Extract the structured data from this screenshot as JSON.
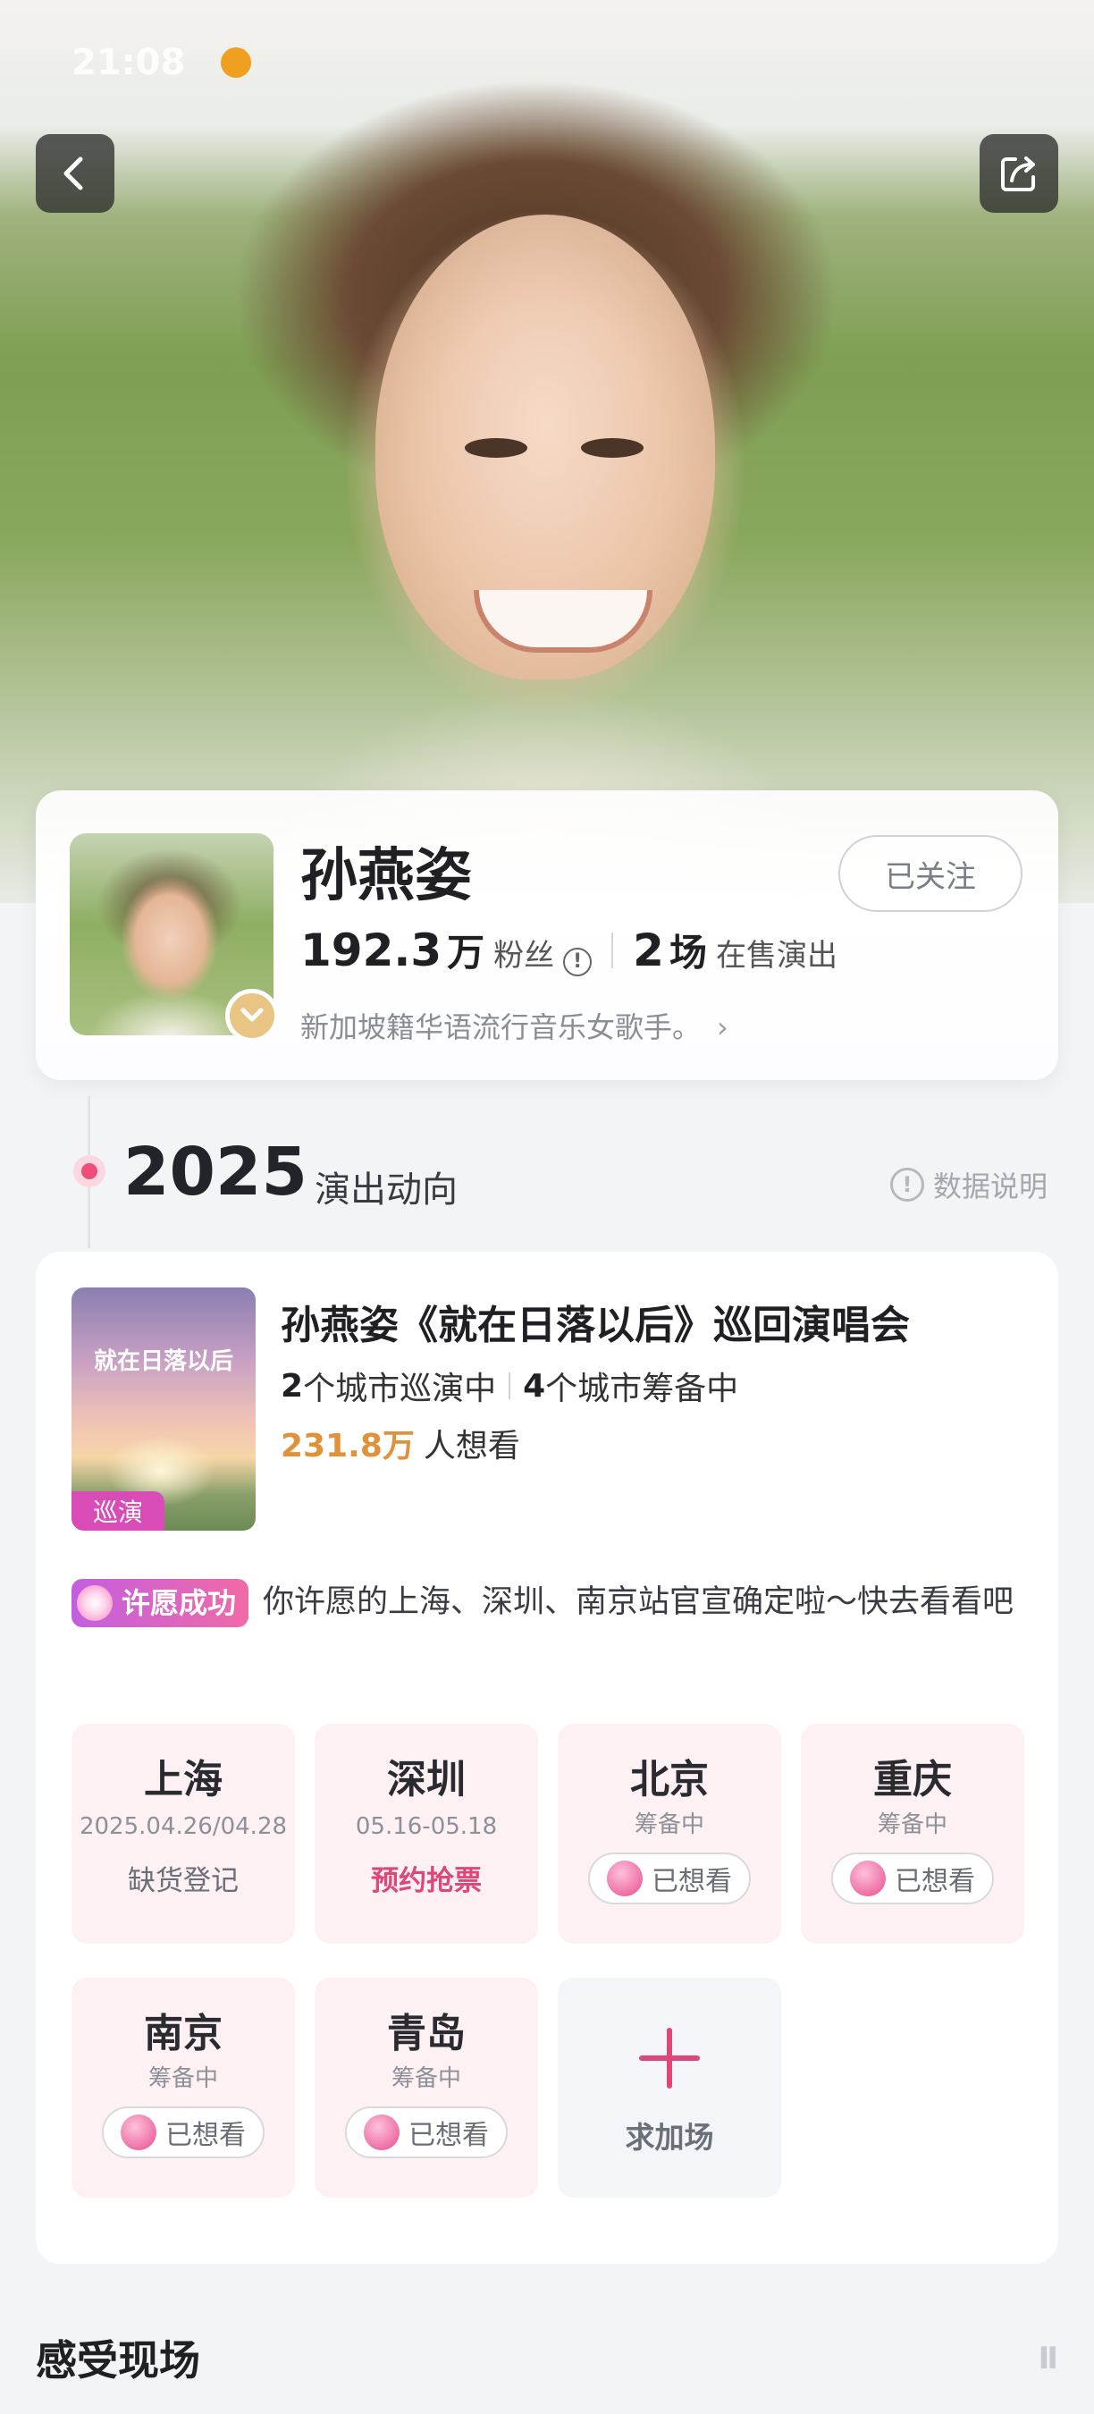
{
  "status_bar": {
    "time": "21:08"
  },
  "nav": {
    "back_icon": "chevron-left-icon",
    "share_icon": "share-icon"
  },
  "artist": {
    "name": "孙燕姿",
    "follow_label": "已关注",
    "fans_num": "192.3",
    "fans_unit": "万",
    "fans_label": "粉丝",
    "shows_num": "2",
    "shows_unit": "场",
    "shows_label": "在售演出",
    "bio": "新加坡籍华语流行音乐女歌手。"
  },
  "timeline": {
    "year": "2025",
    "subtitle": "演出动向",
    "data_note": "数据说明"
  },
  "tour": {
    "poster_title": "就在日落以后",
    "poster_tag": "巡演",
    "title": "孙燕姿《就在日落以后》巡回演唱会",
    "touring_count": "2",
    "touring_label": "个城市巡演中",
    "prep_count": "4",
    "prep_label": "个城市筹备中",
    "want_num": "231.8万",
    "want_label": "人想看",
    "wish_badge": "许愿成功",
    "wish_text": "你许愿的上海、深圳、南京站官宣确定啦～快去看看吧",
    "cities": [
      {
        "name": "上海",
        "date": "2025.04.26/04.28",
        "action": "缺货登记"
      },
      {
        "name": "深圳",
        "date": "05.16-05.18",
        "action": "预约抢票"
      },
      {
        "name": "北京",
        "date": "筹备中",
        "pill": "已想看"
      },
      {
        "name": "重庆",
        "date": "筹备中",
        "pill": "已想看"
      },
      {
        "name": "南京",
        "date": "筹备中",
        "pill": "已想看"
      },
      {
        "name": "青岛",
        "date": "筹备中",
        "pill": "已想看"
      }
    ],
    "request_label": "求加场"
  },
  "section": {
    "title": "感受现场"
  },
  "colors": {
    "accent_pink": "#e0467a",
    "want_orange": "#e0923a",
    "badge_purple": "#d94bb6"
  }
}
